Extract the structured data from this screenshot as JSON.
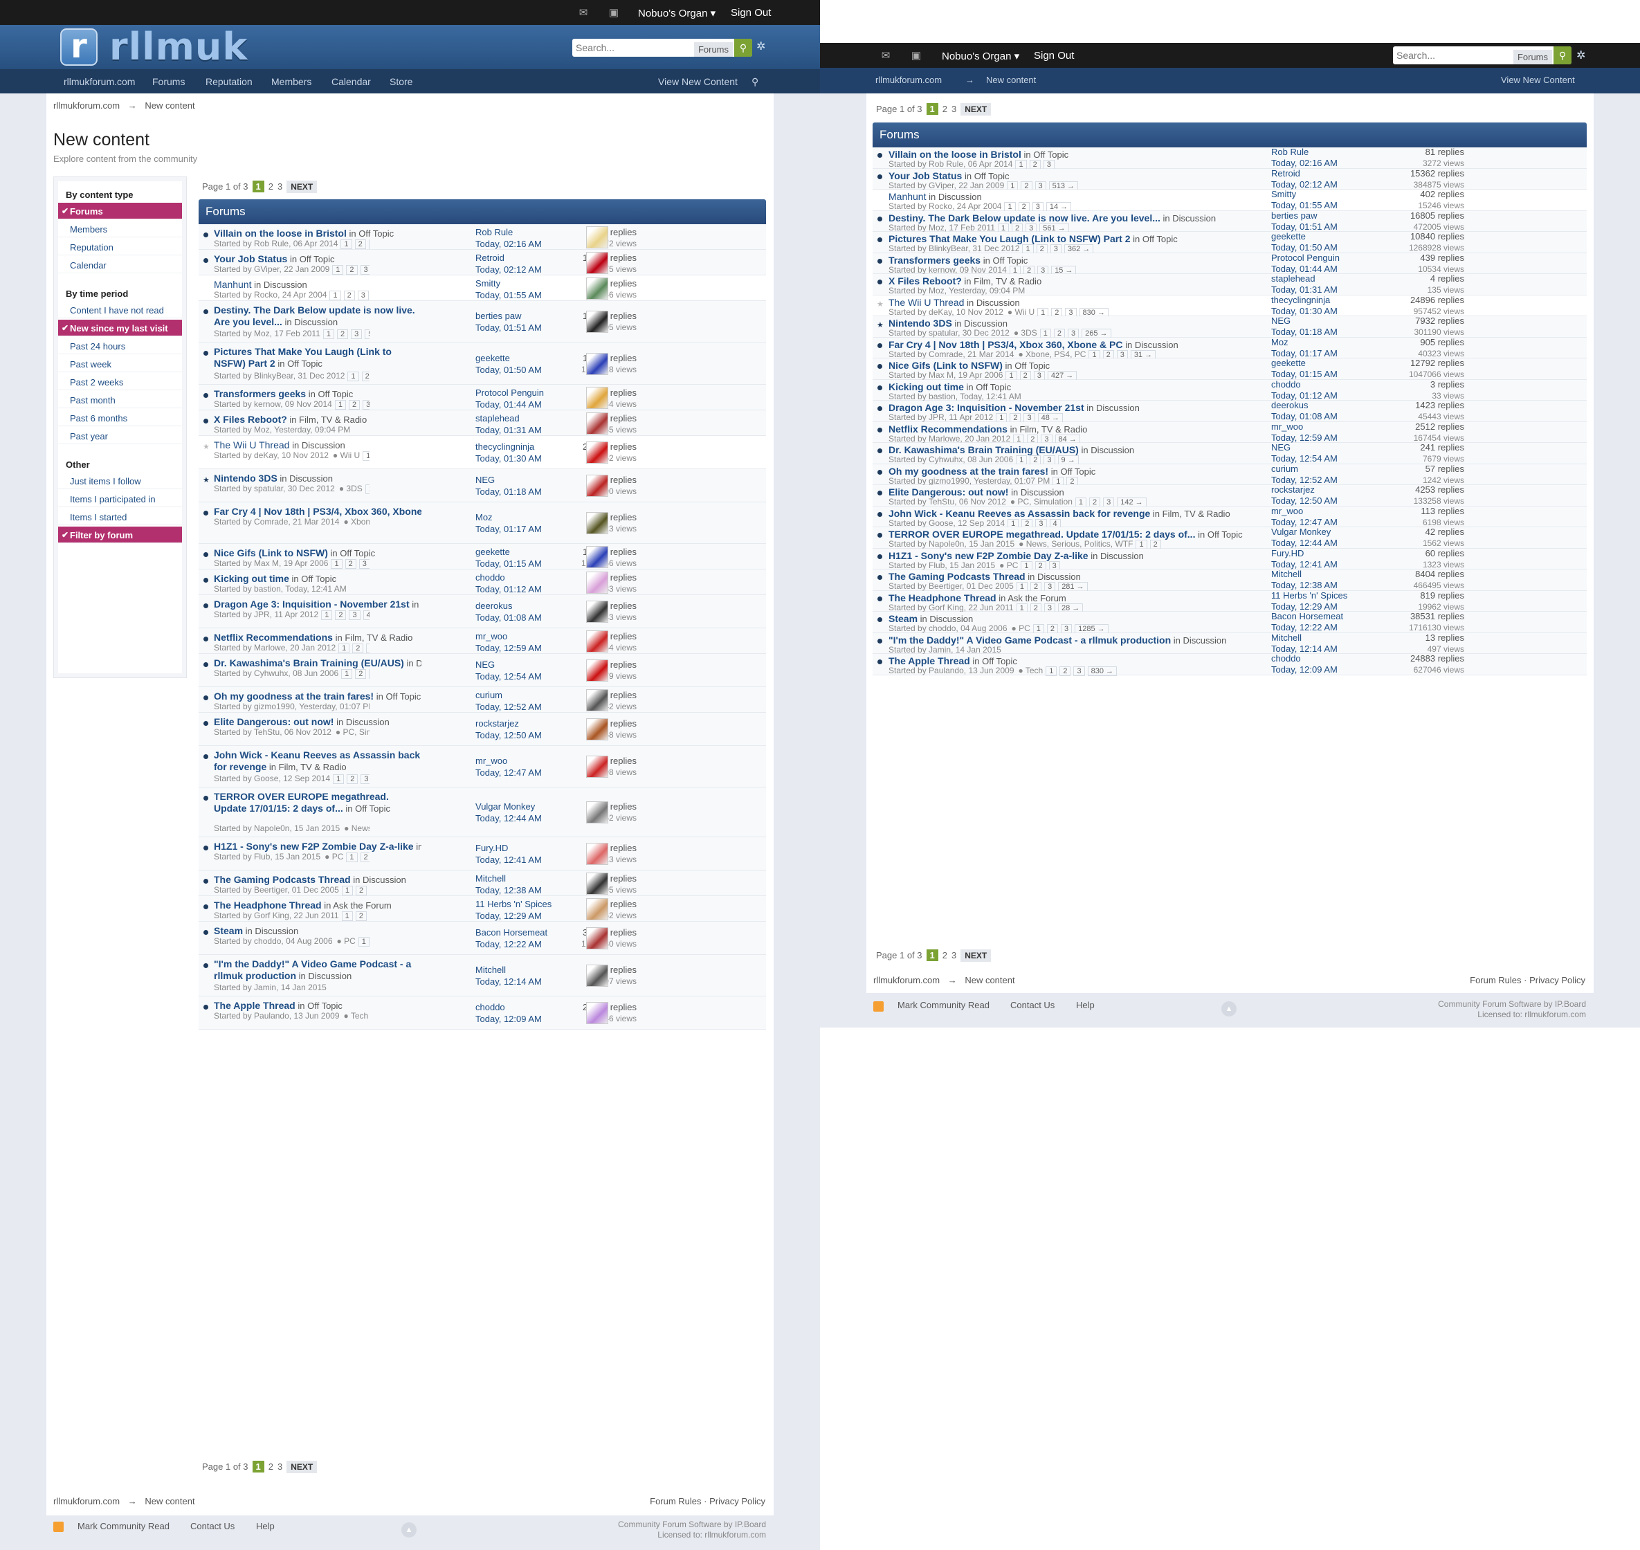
{
  "user": {
    "name": "Nobuo's Organ",
    "sign_out": "Sign Out"
  },
  "site": {
    "logo_letter": "r",
    "logo_text": "rllmuk"
  },
  "search": {
    "placeholder": "Search...",
    "scope": "Forums"
  },
  "nav": {
    "items": [
      "rllmukforum.com",
      "Forums",
      "Reputation",
      "Members",
      "Calendar",
      "Store"
    ],
    "view_new": "View New Content"
  },
  "breadcrumb": {
    "home": "rllmukforum.com",
    "arrow": "→",
    "current": "New content"
  },
  "page": {
    "title": "New content",
    "subtitle": "Explore content from the community"
  },
  "sidebar": {
    "sections": [
      {
        "heading": "By content type",
        "items": [
          {
            "label": "Forums",
            "active": true
          },
          {
            "label": "Members"
          },
          {
            "label": "Reputation"
          },
          {
            "label": "Calendar"
          }
        ]
      },
      {
        "heading": "By time period",
        "items": [
          {
            "label": "Content I have not read"
          },
          {
            "label": "New since my last visit",
            "active": true
          },
          {
            "label": "Past 24 hours"
          },
          {
            "label": "Past week"
          },
          {
            "label": "Past 2 weeks"
          },
          {
            "label": "Past month"
          },
          {
            "label": "Past 6 months"
          },
          {
            "label": "Past year"
          }
        ]
      },
      {
        "heading": "Other",
        "items": [
          {
            "label": "Just items I follow"
          },
          {
            "label": "Items I participated in"
          },
          {
            "label": "Items I started"
          },
          {
            "label": "Filter by forum",
            "active": true
          }
        ]
      }
    ]
  },
  "pagination": {
    "label": "Page 1 of 3",
    "pages": [
      "1",
      "2",
      "3"
    ],
    "next": "NEXT"
  },
  "forum_header": "Forums",
  "topics": [
    {
      "title": "Villain on the loose in Bristol",
      "forum": "Off Topic",
      "starter": "Rob Rule",
      "date": "06 Apr 2014",
      "pages": [
        "1",
        "2",
        "3"
      ],
      "replies": "81 replies",
      "views": "3272 views",
      "last_user": "Rob Rule",
      "last_time": "Today, 02:16 AM",
      "status": "unread"
    },
    {
      "title": "Your Job Status",
      "forum": "Off Topic",
      "starter": "GViper",
      "date": "22 Jan 2009",
      "pages": [
        "1",
        "2",
        "3",
        "513 →"
      ],
      "replies": "15362 replies",
      "views": "384875 views",
      "last_user": "Retroid",
      "last_time": "Today, 02:12 AM",
      "status": "unread"
    },
    {
      "title": "Manhunt",
      "forum": "Discussion",
      "starter": "Rocko",
      "date": "24 Apr 2004",
      "pages": [
        "1",
        "2",
        "3",
        "14 →"
      ],
      "replies": "402 replies",
      "views": "15246 views",
      "last_user": "Smitty",
      "last_time": "Today, 01:55 AM",
      "status": "read"
    },
    {
      "title": "Destiny. The Dark Below update is now live. Are you level...",
      "forum": "Discussion",
      "starter": "Moz",
      "date": "17 Feb 2011",
      "pages": [
        "1",
        "2",
        "3",
        "561 →"
      ],
      "replies": "16805 replies",
      "views": "472005 views",
      "last_user": "berties paw",
      "last_time": "Today, 01:51 AM",
      "status": "unread"
    },
    {
      "title": "Pictures That Make You Laugh (Link to NSFW) Part 2",
      "forum": "Off Topic",
      "starter": "BlinkyBear",
      "date": "31 Dec 2012",
      "pages": [
        "1",
        "2",
        "3",
        "362 →"
      ],
      "replies": "10840 replies",
      "views": "1268928 views",
      "last_user": "geekette",
      "last_time": "Today, 01:50 AM",
      "status": "unread"
    },
    {
      "title": "Transformers geeks",
      "forum": "Off Topic",
      "starter": "kernow",
      "date": "09 Nov 2014",
      "pages": [
        "1",
        "2",
        "3",
        "15 →"
      ],
      "replies": "439 replies",
      "views": "10534 views",
      "last_user": "Protocol Penguin",
      "last_time": "Today, 01:44 AM",
      "status": "unread"
    },
    {
      "title": "X Files Reboot?",
      "forum": "Film, TV & Radio",
      "starter": "Moz",
      "date": "Yesterday, 09:04 PM",
      "pages": [],
      "replies": "4 replies",
      "views": "135 views",
      "last_user": "staplehead",
      "last_time": "Today, 01:31 AM",
      "status": "unread"
    },
    {
      "title": "The Wii U Thread",
      "forum": "Discussion",
      "starter": "deKay",
      "date": "10 Nov 2012",
      "tags": "Wii U",
      "pages": [
        "1",
        "2",
        "3",
        "830 →"
      ],
      "replies": "24896 replies",
      "views": "957452 views",
      "last_user": "thecyclingninja",
      "last_time": "Today, 01:30 AM",
      "status": "star-read"
    },
    {
      "title": "Nintendo 3DS",
      "forum": "Discussion",
      "starter": "spatular",
      "date": "30 Dec 2012",
      "tags": "3DS",
      "pages": [
        "1",
        "2",
        "3",
        "265 →"
      ],
      "replies": "7932 replies",
      "views": "301190 views",
      "last_user": "NEG",
      "last_time": "Today, 01:18 AM",
      "status": "star"
    },
    {
      "title": "Far Cry 4 | Nov 18th | PS3/4, Xbox 360, Xbone & PC",
      "forum": "Discussion",
      "starter": "Comrade",
      "date": "21 Mar 2014",
      "tags": "Xbone, PS4, PC",
      "pages": [
        "1",
        "2",
        "3",
        "31 →"
      ],
      "replies": "905 replies",
      "views": "40323 views",
      "last_user": "Moz",
      "last_time": "Today, 01:17 AM",
      "status": "unread"
    },
    {
      "title": "Nice Gifs (Link to NSFW)",
      "forum": "Off Topic",
      "starter": "Max M",
      "date": "19 Apr 2006",
      "pages": [
        "1",
        "2",
        "3",
        "427 →"
      ],
      "replies": "12792 replies",
      "views": "1047066 views",
      "last_user": "geekette",
      "last_time": "Today, 01:15 AM",
      "status": "unread"
    },
    {
      "title": "Kicking out time",
      "forum": "Off Topic",
      "starter": "bastion",
      "date": "Today, 12:41 AM",
      "pages": [],
      "replies": "3 replies",
      "views": "33 views",
      "last_user": "choddo",
      "last_time": "Today, 01:12 AM",
      "status": "unread"
    },
    {
      "title": "Dragon Age 3: Inquisition - November 21st",
      "forum": "Discussion",
      "starter": "JPR",
      "date": "11 Apr 2012",
      "pages": [
        "1",
        "2",
        "3",
        "48 →"
      ],
      "replies": "1423 replies",
      "views": "45443 views",
      "last_user": "deerokus",
      "last_time": "Today, 01:08 AM",
      "status": "unread"
    },
    {
      "title": "Netflix Recommendations",
      "forum": "Film, TV & Radio",
      "starter": "Marlowe",
      "date": "20 Jan 2012",
      "pages": [
        "1",
        "2",
        "3",
        "84 →"
      ],
      "replies": "2512 replies",
      "views": "167454 views",
      "last_user": "mr_woo",
      "last_time": "Today, 12:59 AM",
      "status": "unread"
    },
    {
      "title": "Dr. Kawashima's Brain Training (EU/AUS)",
      "forum": "Discussion",
      "starter": "Cyhwuhx",
      "date": "08 Jun 2006",
      "pages": [
        "1",
        "2",
        "3",
        "9 →"
      ],
      "replies": "241 replies",
      "views": "7679 views",
      "last_user": "NEG",
      "last_time": "Today, 12:54 AM",
      "status": "unread"
    },
    {
      "title": "Oh my goodness at the train fares!",
      "forum": "Off Topic",
      "starter": "gizmo1990",
      "date": "Yesterday, 01:07 PM",
      "pages": [
        "1",
        "2"
      ],
      "replies": "57 replies",
      "views": "1242 views",
      "last_user": "curium",
      "last_time": "Today, 12:52 AM",
      "status": "unread"
    },
    {
      "title": "Elite Dangerous: out now!",
      "forum": "Discussion",
      "starter": "TehStu",
      "date": "06 Nov 2012",
      "tags": "PC, Simulation",
      "pages": [
        "1",
        "2",
        "3",
        "142 →"
      ],
      "replies": "4253 replies",
      "views": "133258 views",
      "last_user": "rockstarjez",
      "last_time": "Today, 12:50 AM",
      "status": "unread"
    },
    {
      "title": "John Wick - Keanu Reeves as Assassin back for revenge",
      "forum": "Film, TV & Radio",
      "starter": "Goose",
      "date": "12 Sep 2014",
      "pages": [
        "1",
        "2",
        "3",
        "4"
      ],
      "replies": "113 replies",
      "views": "6198 views",
      "last_user": "mr_woo",
      "last_time": "Today, 12:47 AM",
      "status": "unread"
    },
    {
      "title": "TERROR OVER EUROPE megathread. Update 17/01/15: 2 days of...",
      "forum": "Off Topic",
      "starter": "Napole0n",
      "date": "15 Jan 2015",
      "tags": "News, Serious, Politics, WTF",
      "pages": [
        "1",
        "2"
      ],
      "replies": "42 replies",
      "views": "1562 views",
      "last_user": "Vulgar Monkey",
      "last_time": "Today, 12:44 AM",
      "status": "unread"
    },
    {
      "title": "H1Z1 - Sony's new F2P Zombie Day Z-a-like",
      "forum": "Discussion",
      "starter": "Flub",
      "date": "15 Jan 2015",
      "tags": "PC",
      "pages": [
        "1",
        "2",
        "3"
      ],
      "replies": "60 replies",
      "views": "1323 views",
      "last_user": "Fury.HD",
      "last_time": "Today, 12:41 AM",
      "status": "unread"
    },
    {
      "title": "The Gaming Podcasts Thread",
      "forum": "Discussion",
      "starter": "Beertiger",
      "date": "01 Dec 2005",
      "pages": [
        "1",
        "2",
        "3",
        "281 →"
      ],
      "replies": "8404 replies",
      "views": "466495 views",
      "last_user": "Mitchell",
      "last_time": "Today, 12:38 AM",
      "status": "unread"
    },
    {
      "title": "The Headphone Thread",
      "forum": "Ask the Forum",
      "starter": "Gorf King",
      "date": "22 Jun 2011",
      "pages": [
        "1",
        "2",
        "3",
        "28 →"
      ],
      "replies": "819 replies",
      "views": "19962 views",
      "last_user": "11 Herbs 'n' Spices",
      "last_time": "Today, 12:29 AM",
      "status": "unread"
    },
    {
      "title": "Steam",
      "forum": "Discussion",
      "starter": "choddo",
      "date": "04 Aug 2006",
      "tags": "PC",
      "pages": [
        "1",
        "2",
        "3",
        "1285 →"
      ],
      "replies": "38531 replies",
      "views": "1716130 views",
      "last_user": "Bacon Horsemeat",
      "last_time": "Today, 12:22 AM",
      "status": "unread"
    },
    {
      "title": "\"I'm the Daddy!\" A Video Game Podcast - a rllmuk production",
      "forum": "Discussion",
      "starter": "Jamin",
      "date": "14 Jan 2015",
      "pages": [],
      "replies": "13 replies",
      "views": "497 views",
      "last_user": "Mitchell",
      "last_time": "Today, 12:14 AM",
      "status": "unread"
    },
    {
      "title": "The Apple Thread",
      "forum": "Off Topic",
      "starter": "Paulando",
      "date": "13 Jun 2009",
      "tags": "Tech",
      "pages": [
        "1",
        "2",
        "3",
        "830 →"
      ],
      "replies": "24883 replies",
      "views": "627046 views",
      "last_user": "choddo",
      "last_time": "Today, 12:09 AM",
      "status": "unread"
    }
  ],
  "prefix_badges": {
    "wii": "Wii U",
    "3ds": "3DS",
    "pc": "PC"
  },
  "words": {
    "in": "in",
    "started_by": "Started by"
  },
  "footer": {
    "links_right": "Forum Rules · Privacy Policy",
    "mark_read": "Mark Community Read",
    "contact": "Contact Us",
    "help": "Help",
    "copyright": "Community Forum Software by IP.Board",
    "licensed": "Licensed to: rllmukforum.com"
  },
  "colors": {
    "accent": "#b3306e",
    "brand": "#2c5a8c",
    "green": "#7ba233"
  }
}
